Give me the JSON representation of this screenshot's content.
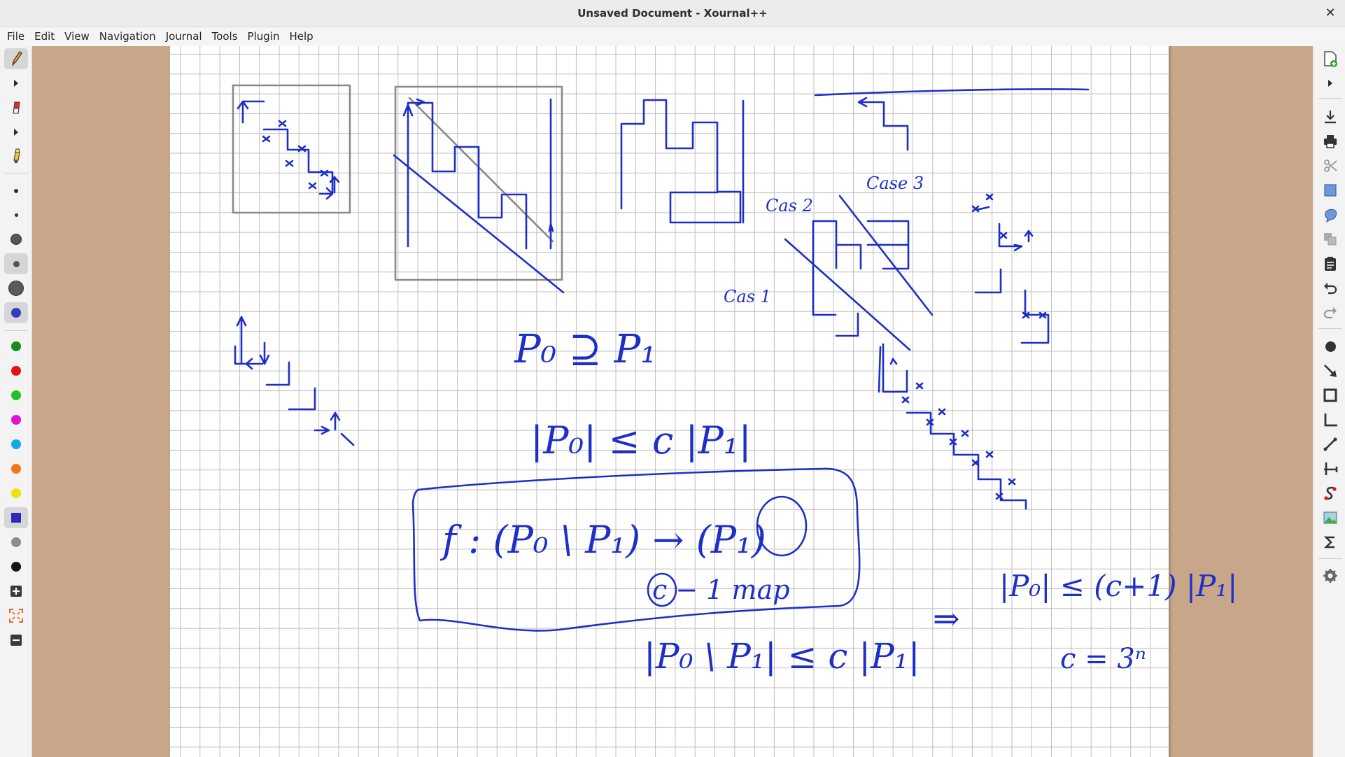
{
  "window": {
    "title": "Unsaved Document - Xournal++",
    "close_glyph": "✕"
  },
  "menu": [
    "File",
    "Edit",
    "View",
    "Navigation",
    "Journal",
    "Tools",
    "Plugin",
    "Help"
  ],
  "left_toolbar": {
    "tools": [
      "pen-icon",
      "eraser-icon",
      "highlighter-icon"
    ],
    "thickness": [
      "very-fine",
      "fine",
      "medium",
      "thick",
      "very-thick"
    ],
    "colors": [
      "#1a8a1a",
      "#e01414",
      "#22c322",
      "#e014d2",
      "#14a7e6",
      "#f07814",
      "#f0e014",
      "#2b2bb8",
      "#8c8c8c",
      "#141414"
    ],
    "active_color": "#2f3fbf"
  },
  "right_toolbar": [
    "new-page-icon",
    "save-icon",
    "print-icon",
    "cut-icon",
    "select-rect-icon",
    "select-region-icon",
    "copy-icon",
    "paste-icon",
    "undo-icon",
    "redo-icon",
    "dot-tool-icon",
    "arrow-tool-icon",
    "rectangle-tool-icon",
    "coordinate-system-icon",
    "line-tool-icon",
    "spline-icon",
    "latex-icon",
    "image-icon",
    "formula-icon",
    "settings-icon"
  ],
  "canvas": {
    "ink_color": "#1e2fc8",
    "labels": {
      "case1": "Cas 1",
      "case2": "Cas 2",
      "case3": "Case 3",
      "p0_ge_p1": "P₀ ⊇ P₁",
      "bound": "|P₀| ≤ c |P₁|",
      "f_map": "f : (P₀ \\ P₁) → (P₁)",
      "c1_map": "c − 1 map",
      "diff_bound": "|P₀ \\ P₁| ≤ c |P₁|",
      "implies": "⇒",
      "result": "|P₀| ≤ (c+1) |P₁|",
      "c_eq": "c = 3ⁿ"
    }
  }
}
